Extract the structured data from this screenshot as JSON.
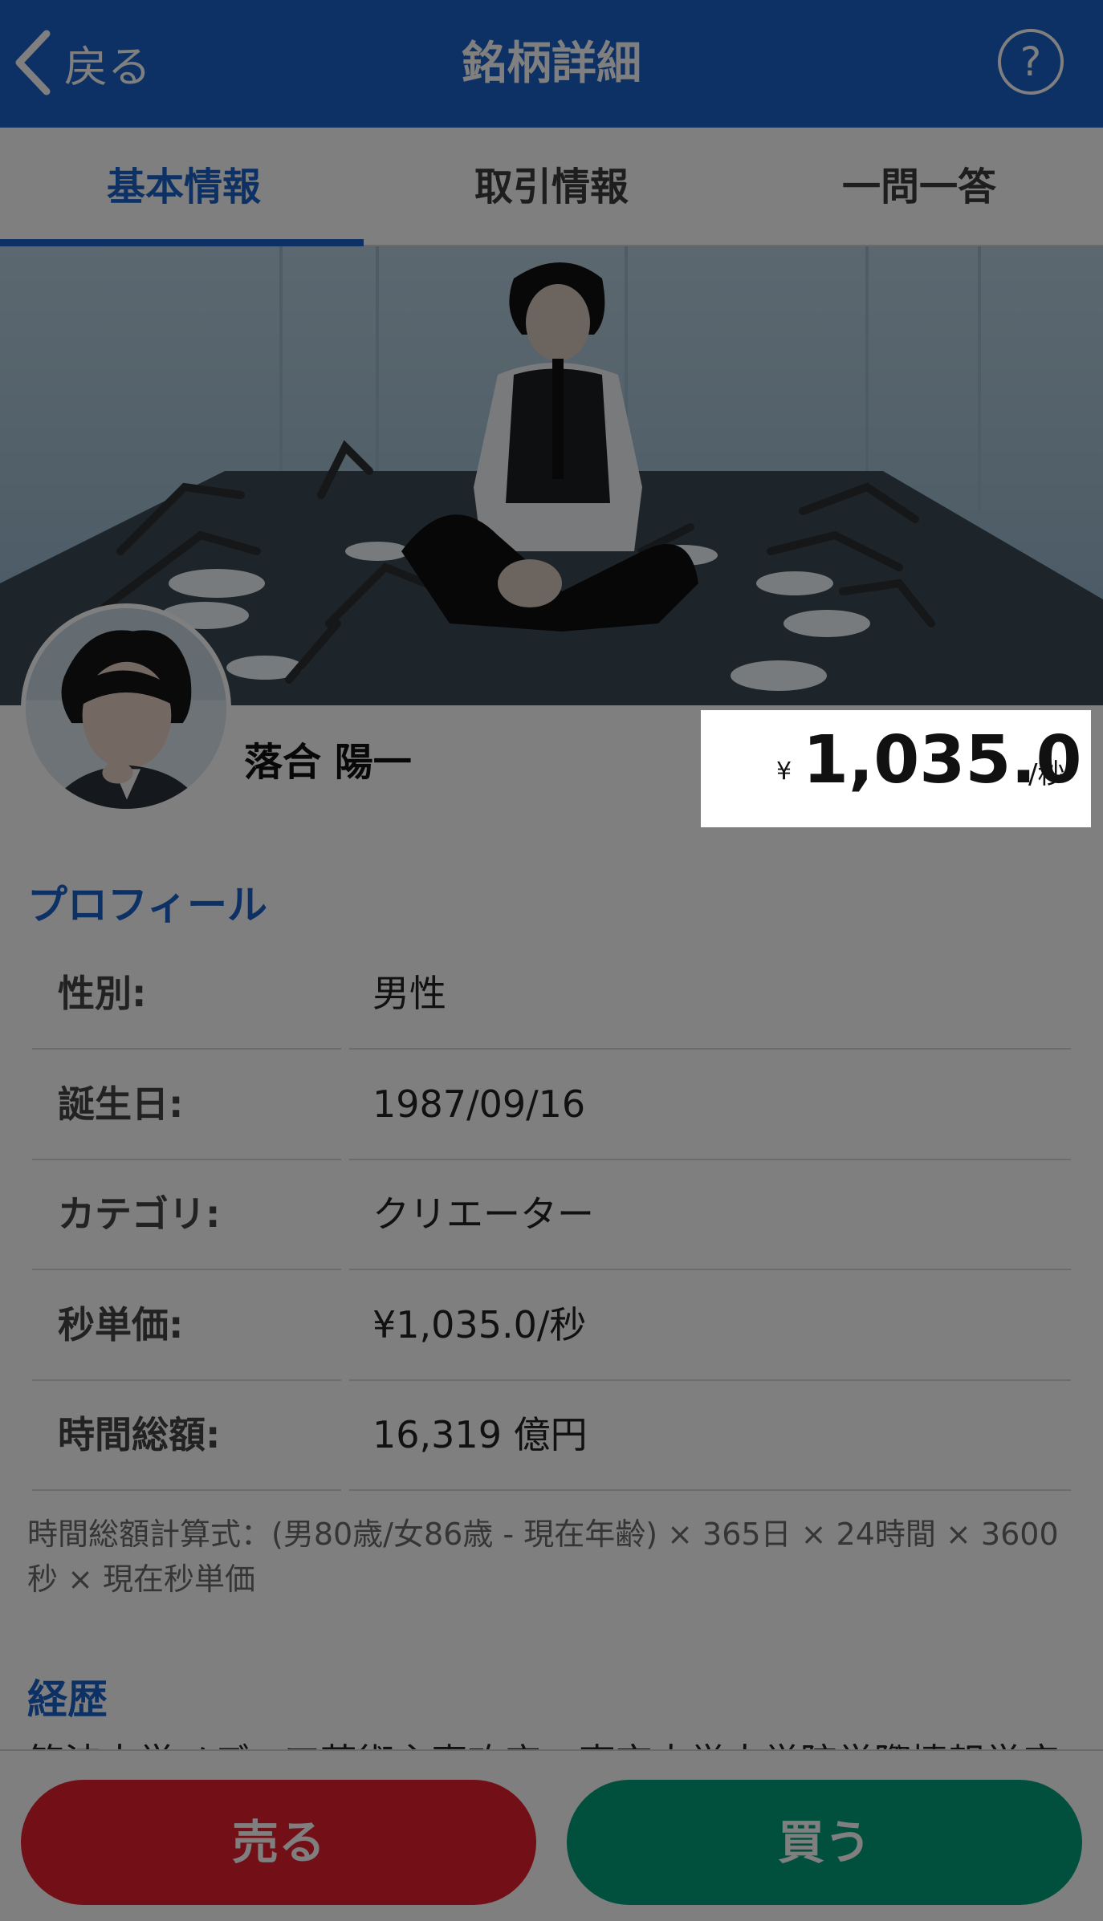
{
  "header": {
    "back_label": "戻る",
    "title": "銘柄詳細",
    "help_label": "?"
  },
  "tabs": [
    {
      "label": "基本情報",
      "active": true
    },
    {
      "label": "取引情報",
      "active": false
    },
    {
      "label": "一問一答",
      "active": false
    }
  ],
  "person": {
    "name": "落合 陽一",
    "price_yen_symbol": "¥",
    "price_value": "1,035.0",
    "price_unit": "/秒"
  },
  "profile": {
    "title": "プロフィール",
    "rows": [
      {
        "label": "性別:",
        "value": "男性"
      },
      {
        "label": "誕生日:",
        "value": "1987/09/16"
      },
      {
        "label": "カテゴリ:",
        "value": "クリエーター"
      },
      {
        "label": "秒単価:",
        "value": "¥1,035.0/秒"
      },
      {
        "label": "時間総額:",
        "value": "16,319 億円"
      }
    ],
    "formula": "時間総額計算式：(男80歳/女86歳 - 現在年齢) × 365日 × 24時間 × 3600秒 × 現在秒単価"
  },
  "career": {
    "title": "経歴",
    "text": "筑波大学メディア芸術主専攻卒、東京大学大学院学際情報学府博士"
  },
  "actions": {
    "sell_label": "売る",
    "buy_label": "買う"
  },
  "colors": {
    "brand_blue": "#1a63c9",
    "sell_red": "#e61e2f",
    "buy_green": "#00a07a",
    "overlay": "rgba(0,0,0,0.5)"
  },
  "icons": {
    "back": "chevron-left-icon",
    "help": "question-circle-icon"
  }
}
